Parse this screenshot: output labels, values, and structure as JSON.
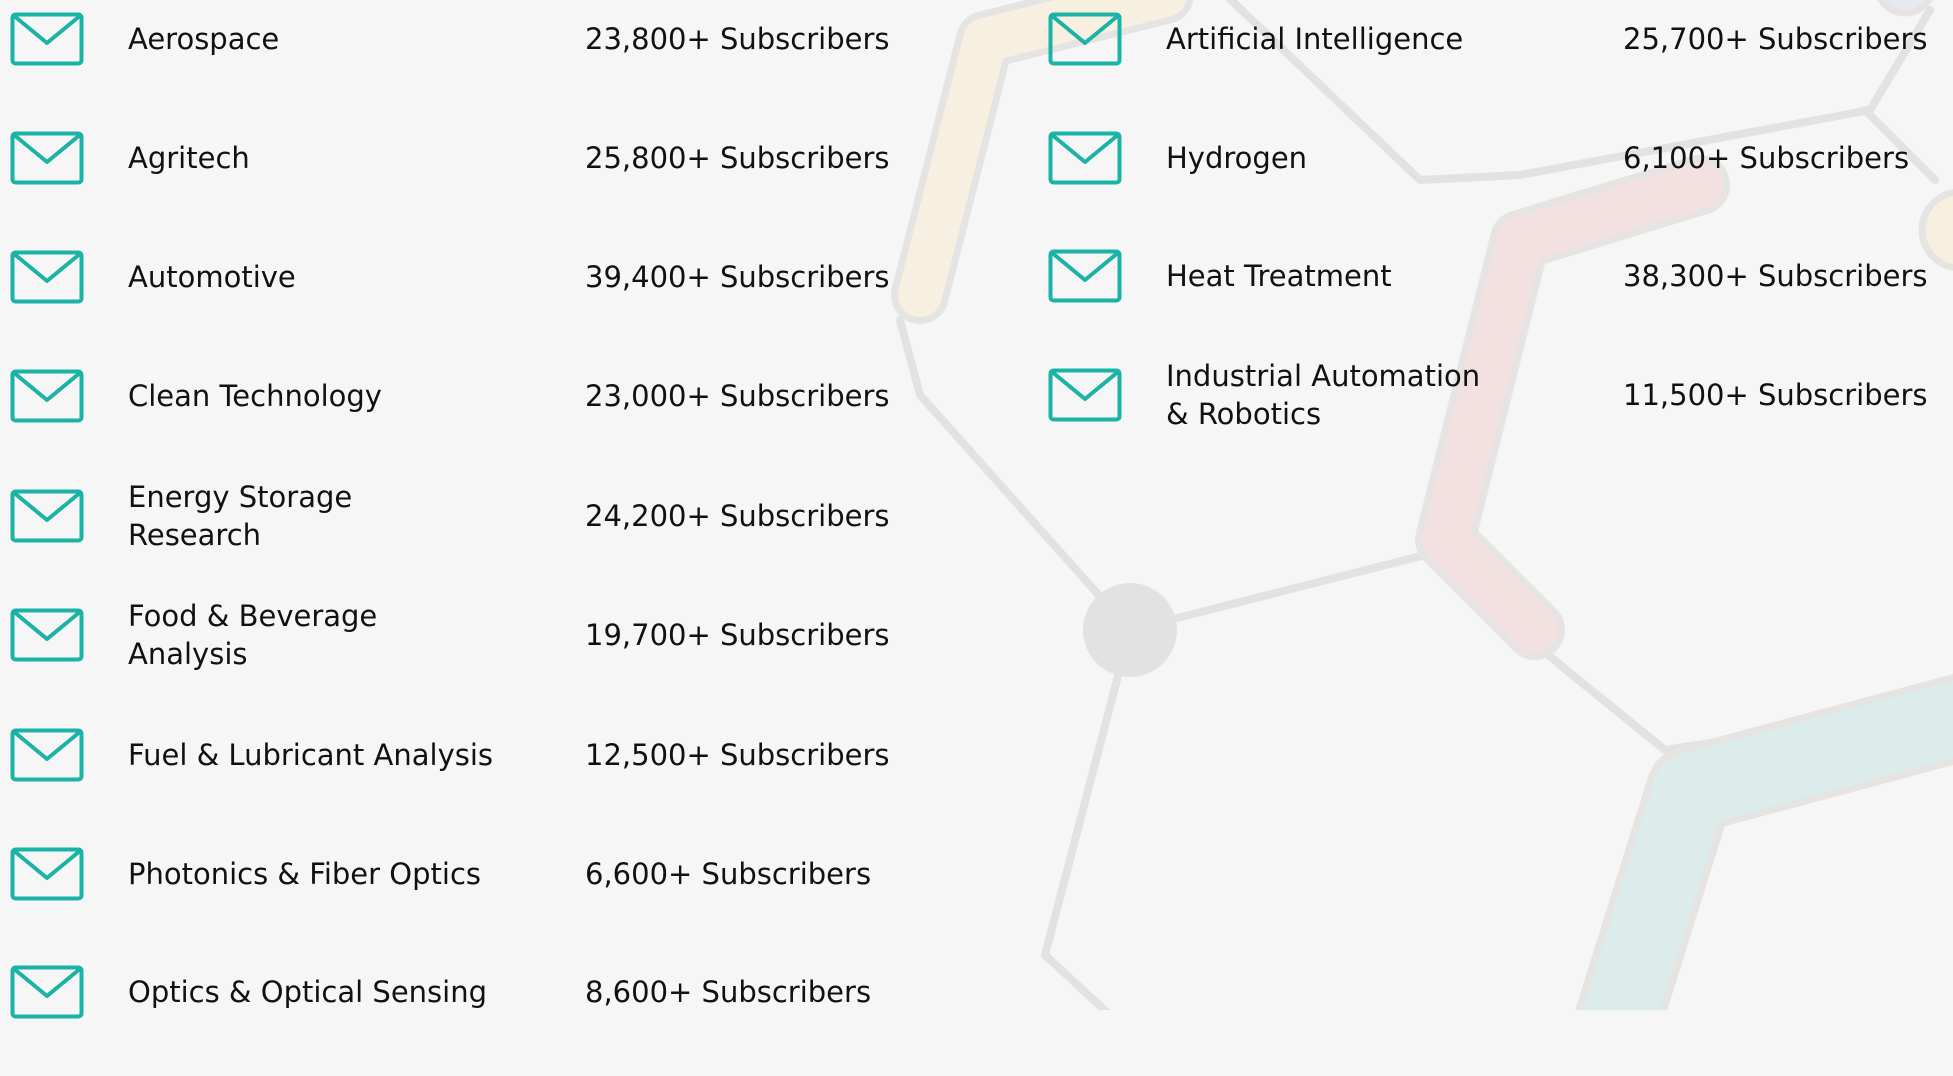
{
  "icon": "mail-icon",
  "colors": {
    "background": "#f7f6f6",
    "icon_teal": "#1ab3a6",
    "text": "#111111",
    "line_gray": "#e2e2e2",
    "hex_yellow": "#f7f0e0",
    "hex_pink": "#f3e1e1",
    "hex_teal": "#dcecea"
  },
  "left": [
    {
      "name": "Aerospace",
      "count": "23,800+ Subscribers"
    },
    {
      "name": "Agritech",
      "count": "25,800+ Subscribers"
    },
    {
      "name": "Automotive",
      "count": "39,400+ Subscribers"
    },
    {
      "name": "Clean Technology",
      "count": "23,000+ Subscribers"
    },
    {
      "name": "Energy Storage\nResearch",
      "count": "24,200+ Subscribers"
    },
    {
      "name": "Food & Beverage\nAnalysis",
      "count": "19,700+ Subscribers"
    },
    {
      "name": "Fuel & Lubricant Analysis",
      "count": "12,500+ Subscribers"
    },
    {
      "name": "Photonics & Fiber Optics",
      "count": "6,600+ Subscribers"
    },
    {
      "name": "Optics & Optical Sensing",
      "count": "8,600+ Subscribers"
    }
  ],
  "right": [
    {
      "name": "Artificial Intelligence",
      "count": "25,700+ Subscribers"
    },
    {
      "name": "Hydrogen",
      "count": "6,100+ Subscribers"
    },
    {
      "name": "Heat Treatment",
      "count": "38,300+ Subscribers"
    },
    {
      "name": "Industrial Automation\n& Robotics",
      "count": "11,500+ Subscribers"
    }
  ]
}
